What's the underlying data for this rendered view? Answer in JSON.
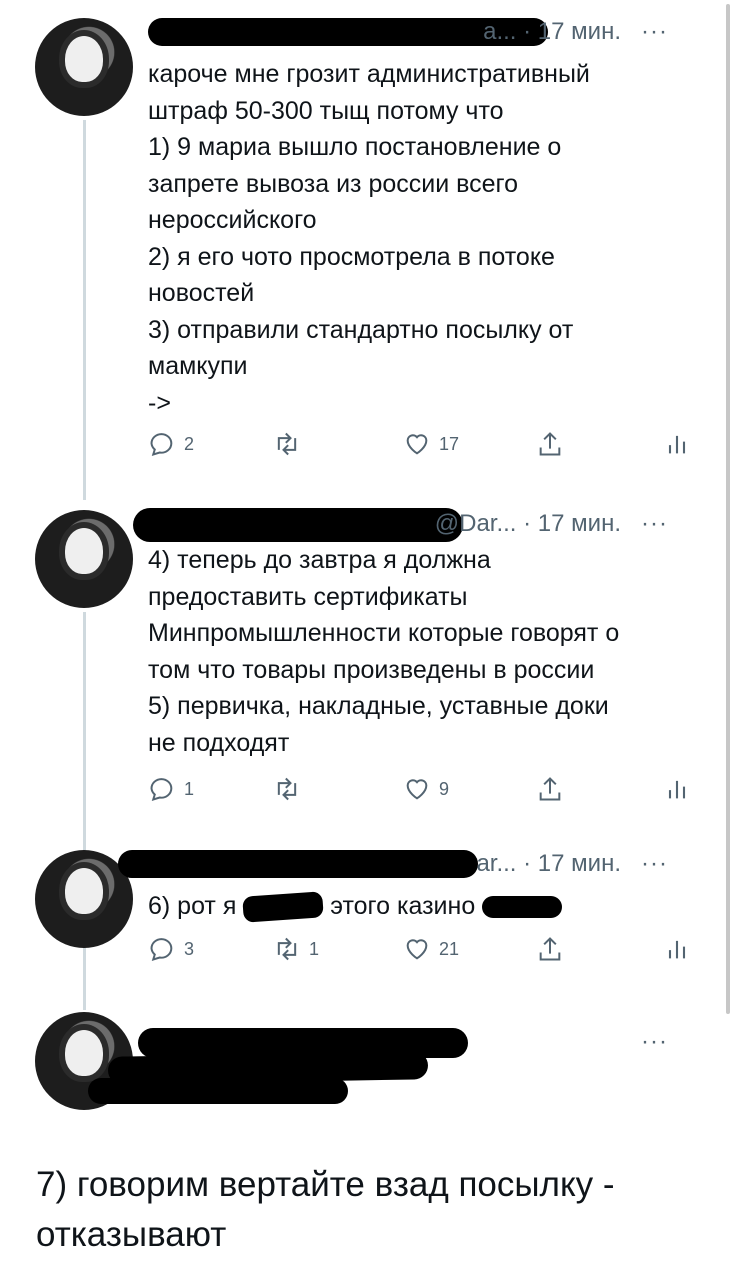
{
  "tweets": [
    {
      "handle_fragment": "а...",
      "time": "17 мин.",
      "more": "···",
      "text": "кароче мне грозит административный\nштраф 50-300 тыщ потому что\n1) 9 мариа вышло постановление о\nзапрете вывоза из россии всего\nнероссийского\n2) я его чото просмотрела в потоке\nновостей\n3) отправили стандартно посылку от\nмамкупи\n->",
      "replies": "2",
      "retweets": "",
      "likes": "17"
    },
    {
      "handle_fragment": "@Dar...",
      "time": "17 мин.",
      "more": "···",
      "text": "4) теперь до завтра я должна\nпредоставить сертификаты\nМинпромышленности которые говорят о\nтом что товары произведены в россии\n5) первичка, накладные, уставные доки\nне подходят",
      "replies": "1",
      "retweets": "",
      "likes": "9"
    },
    {
      "handle_fragment": "ar...",
      "time": "17 мин.",
      "more": "···",
      "text_prefix": "6) рот я",
      "text_suffix": "этого казино",
      "replies": "3",
      "retweets": "1",
      "likes": "21"
    },
    {
      "more": "···"
    }
  ],
  "bottom_text": "7) говорим вертайте взад посылку -\nотказывают",
  "icons": [
    "reply-icon",
    "retweet-icon",
    "like-icon",
    "share-icon",
    "analytics-icon"
  ]
}
